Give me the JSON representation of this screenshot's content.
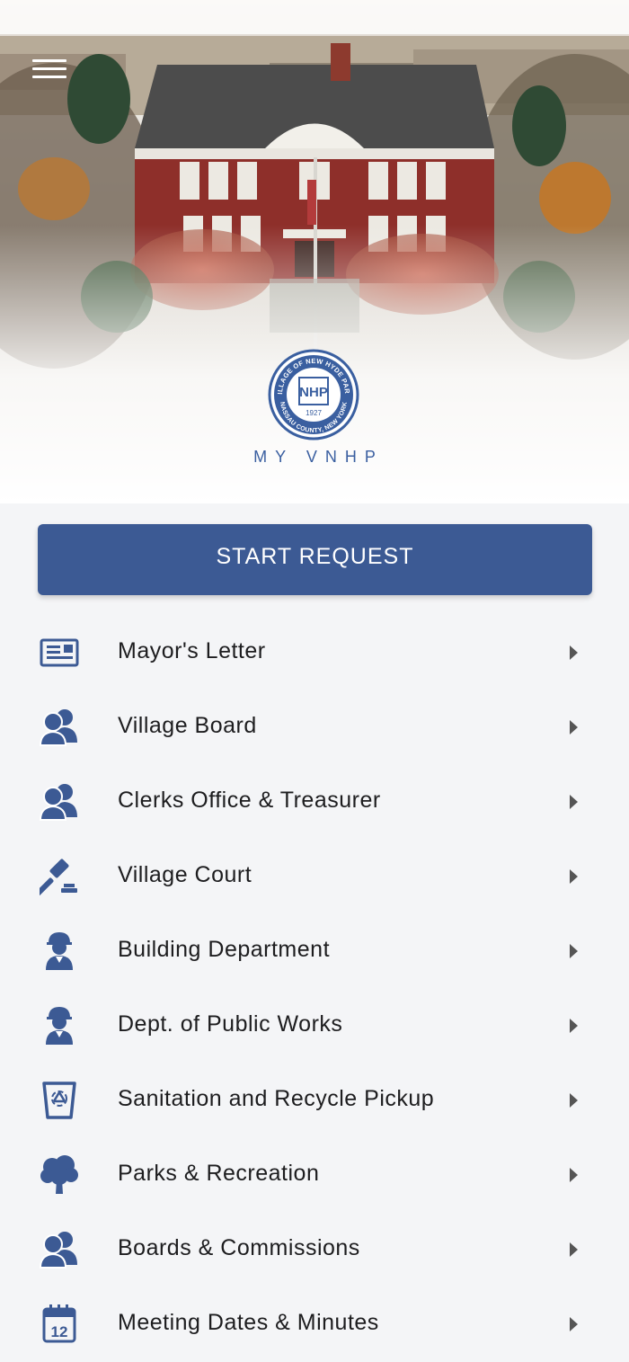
{
  "header": {
    "brand": "MY VNHP",
    "seal_text_top": "VILLAGE OF NEW HYDE PARK",
    "seal_text_bottom": "NASSAU COUNTY, NEW YORK",
    "seal_monogram": "NHP",
    "seal_year": "1927"
  },
  "actions": {
    "start_request": "START REQUEST"
  },
  "menu": [
    {
      "label": "Mayor's Letter",
      "icon": "newspaper-icon"
    },
    {
      "label": "Village Board",
      "icon": "people-icon"
    },
    {
      "label": "Clerks Office & Treasurer",
      "icon": "people-icon"
    },
    {
      "label": "Village Court",
      "icon": "gavel-icon"
    },
    {
      "label": "Building Department",
      "icon": "worker-icon"
    },
    {
      "label": "Dept. of Public Works",
      "icon": "worker-icon"
    },
    {
      "label": "Sanitation and Recycle Pickup",
      "icon": "recycle-bin-icon"
    },
    {
      "label": "Parks & Recreation",
      "icon": "tree-icon"
    },
    {
      "label": "Boards & Commissions",
      "icon": "people-icon"
    },
    {
      "label": "Meeting Dates & Minutes",
      "icon": "calendar-icon"
    }
  ],
  "colors": {
    "accent": "#3c5a94",
    "seal": "#3a5fa0",
    "background": "#f4f5f7"
  }
}
